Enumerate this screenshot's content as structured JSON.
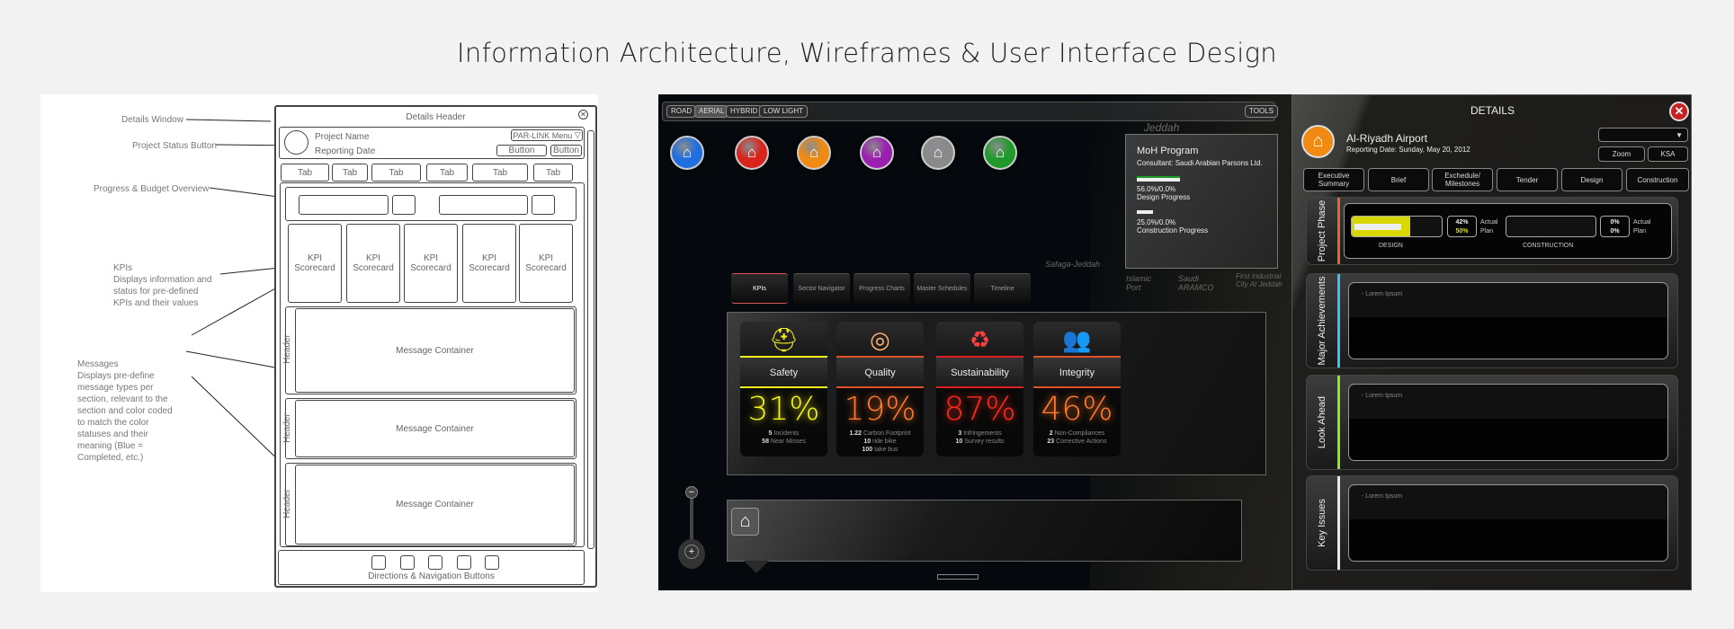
{
  "title": "Information Architecture, Wireframes & User Interface Design",
  "wireframe": {
    "header": "Details Header",
    "project_name": "Project Name",
    "reporting_date": "Reporting Date",
    "menu": "PAR-LINK Menu",
    "buttons": [
      "Button",
      "Button"
    ],
    "tabs": [
      "Tab",
      "Tab",
      "Tab",
      "Tab",
      "Tab",
      "Tab"
    ],
    "kpi_cards": [
      [
        "KPI",
        "Scorecard"
      ],
      [
        "KPI",
        "Scorecard"
      ],
      [
        "KPI",
        "Scorecard"
      ],
      [
        "KPI",
        "Scorecard"
      ],
      [
        "KPI",
        "Scorecard"
      ]
    ],
    "message_header": "Header",
    "message_container": "Message Container",
    "nav": "Directions & Navigation Buttons",
    "annotations": {
      "details_window": "Details Window",
      "status_button": "Project Status Button",
      "progress": "Progress & Budget Overview",
      "kpis_title": "KPIs",
      "kpis_desc": "Displays information and status for pre-defined KPIs and their values",
      "messages_title": "Messages",
      "messages_desc": "Displays pre-define message types per section, relevant to the section and color coded to match the color statuses and their meaning (Blue = Completed, etc.)"
    }
  },
  "map": {
    "view_buttons": [
      "ROAD",
      "AERIAL",
      "HYBRID",
      "LOW LIGHT"
    ],
    "active_view": "AERIAL",
    "tools": "TOOLS",
    "project_icons": [
      {
        "color": "#1f6fe0"
      },
      {
        "color": "#d9241c"
      },
      {
        "color": "#f08a12"
      },
      {
        "color": "#9a1fb0"
      },
      {
        "color": "#8a8a8a"
      },
      {
        "color": "#1f9a2a"
      }
    ],
    "labels": [
      "Jeddah",
      "Safaga-Jeddah",
      "Islamic Port",
      "Saudi ARAMCO",
      "First Industrial City At Jeddah"
    ],
    "program": {
      "title": "MoH Program",
      "consultant": "Consultant: Saudi Arabian Parsons Ltd.",
      "design_value": "56.0%/0.0%",
      "design_label": "Design Progress",
      "design_progress": 56,
      "construction_value": "25.0%/0.0%",
      "construction_label": "Construction Progress",
      "construction_progress": 25
    },
    "tabs": [
      "KPIs",
      "Sector Navigator",
      "Progress Charts",
      "Master Schedules",
      "Timeline"
    ],
    "active_tab": "KPIs",
    "kpis": [
      {
        "name": "Safety",
        "icon": "hard-hat",
        "value": "31%",
        "color": "#f2f21a",
        "stats": [
          [
            "5",
            "Incidents"
          ],
          [
            "58",
            "Near Misses"
          ]
        ]
      },
      {
        "name": "Quality",
        "icon": "target-cursor",
        "value": "19%",
        "color": "#ff7a2a",
        "stats": [
          [
            "1.22",
            "Carbon Footprint"
          ],
          [
            "10",
            "ride bike"
          ],
          [
            "100",
            "take bus"
          ]
        ]
      },
      {
        "name": "Sustainability",
        "icon": "recycle",
        "value": "87%",
        "color": "#ff2a1a",
        "stats": [
          [
            "3",
            "Infringements"
          ],
          [
            "10",
            "Survey results"
          ]
        ]
      },
      {
        "name": "Integrity",
        "icon": "people",
        "value": "46%",
        "color": "#ff7a2a",
        "stats": [
          [
            "2",
            "Non-Compliances"
          ],
          [
            "23",
            "Corrective Actions"
          ]
        ]
      }
    ]
  },
  "details": {
    "title": "DETAILS",
    "project": "Al-Riyadh Airport",
    "date": "Reporting Date: Sunday, May 20, 2012",
    "zoom": "Zoom",
    "region": "KSA",
    "tabs": [
      "Executive Summary",
      "Brief",
      "Exchedule/ Milestones",
      "Tender",
      "Design",
      "Construction"
    ],
    "phase": {
      "label": "Project Phase",
      "design_label": "DESIGN",
      "design_actual": "42%",
      "design_plan": "50%",
      "construction_label": "CONSTRUCTION",
      "construction_actual": "0%",
      "construction_plan": "0%",
      "actual": "Actual",
      "plan": "Plan"
    },
    "sections": [
      {
        "label": "Major Achievements",
        "color": "#2ec8f0",
        "text": "- Lorem Ipsum"
      },
      {
        "label": "Look Ahead",
        "color": "#8ee81c",
        "text": "- Lorem Ipsum"
      },
      {
        "label": "Key Issues",
        "color": "#e8e8e8",
        "text": "- Lorem Ipsum"
      }
    ]
  }
}
